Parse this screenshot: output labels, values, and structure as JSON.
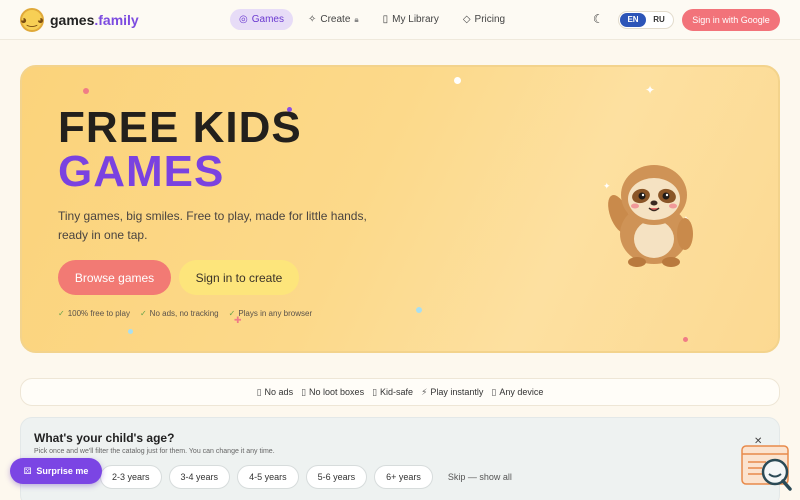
{
  "header": {
    "logo_icon": "sloth-face-icon",
    "logo_main": "games",
    "logo_accent": ".family",
    "nav": [
      {
        "label": "Games",
        "icon": "compass-icon",
        "active": true
      },
      {
        "label": "Create",
        "icon": "sparkle-icon",
        "suffix_icon": "lock-icon"
      },
      {
        "label": "My Library",
        "icon": "book-icon"
      },
      {
        "label": "Pricing",
        "icon": "diamond-icon"
      }
    ],
    "theme_icon": "moon-icon",
    "lang_en": "EN",
    "lang_ru": "RU",
    "signin_label": "Sign in with Google"
  },
  "hero": {
    "title_line1": "FREE KIDS",
    "title_line2": "GAMES",
    "subtitle": "Tiny games, big smiles. Free to play, made for little hands, ready in one tap.",
    "browse_label": "Browse games",
    "signin_label": "Sign in to create",
    "checks": [
      "100% free to play",
      "No ads, no tracking",
      "Plays in any browser"
    ],
    "mascot": "waving-sloth"
  },
  "features": [
    {
      "icon": "no-ads-icon",
      "label": "No ads"
    },
    {
      "icon": "no-loot-icon",
      "label": "No loot boxes"
    },
    {
      "icon": "shield-icon",
      "label": "Kid-safe"
    },
    {
      "icon": "bolt-icon",
      "label": "Play instantly"
    },
    {
      "icon": "device-icon",
      "label": "Any device"
    }
  ],
  "age": {
    "title": "What's your child's age?",
    "subtitle": "Pick once and we'll filter the catalog just for them. You can change it any time.",
    "options": [
      "2-3 years",
      "3-4 years",
      "4-5 years",
      "5-6 years",
      "6+ years"
    ],
    "skip_label": "Skip — show all"
  },
  "surprise_label": "Surprise me",
  "colors": {
    "brand_purple": "#7a42e0",
    "coral": "#f27a74",
    "hero_yellow": "#fbd37b"
  }
}
